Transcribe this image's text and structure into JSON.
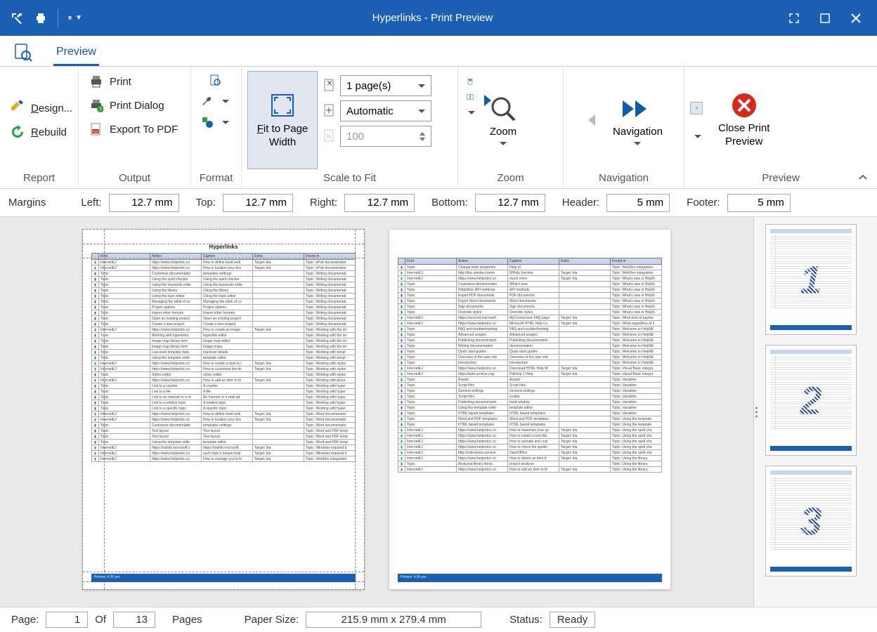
{
  "window": {
    "title": "Hyperlinks - Print Preview"
  },
  "tabs": {
    "preview": "Preview"
  },
  "ribbon": {
    "report": {
      "label": "Report",
      "design": "Design...",
      "rebuild": "Rebuild"
    },
    "output": {
      "label": "Output",
      "print": "Print",
      "print_dialog": "Print Dialog",
      "export_pdf": "Export To PDF"
    },
    "format": {
      "label": "Format"
    },
    "scale": {
      "label": "Scale to Fit",
      "fit_width": "Fit to Page Width",
      "pages_combo": "1 page(s)",
      "auto_combo": "Automatic",
      "zoom_value": "100"
    },
    "zoom": {
      "label": "Zoom",
      "zoom": "Zoom"
    },
    "navigation": {
      "label": "Navigation",
      "navigation": "Navigation"
    },
    "preview": {
      "label": "Preview",
      "close": "Close Print Preview"
    }
  },
  "margins": {
    "label": "Margins",
    "left_l": "Left:",
    "left_v": "12.7 mm",
    "top_l": "Top:",
    "top_v": "12.7 mm",
    "right_l": "Right:",
    "right_v": "12.7 mm",
    "bottom_l": "Bottom:",
    "bottom_v": "12.7 mm",
    "header_l": "Header:",
    "header_v": "5 mm",
    "footer_l": "Footer:",
    "footer_v": "5 mm"
  },
  "document": {
    "title": "Hyperlinks",
    "columns": [
      "Kind",
      "Action",
      "Caption",
      "Extra",
      "Found in"
    ],
    "footer": "Printed: 4:30 pm",
    "page1_rows": [
      [
        "Topic",
        "Change topic properties",
        "Help Id",
        "",
        "Topic: WebDev integration"
      ],
      [
        "InternetEJ",
        "http://doc.windev.com/e",
        "WHelp function",
        "Target: bla",
        "Topic: WebDev integration"
      ],
      [
        "InternetEJ",
        "https://www.helpndoc.co",
        "much more",
        "Target: bla",
        "Topic: What's new in HelpN"
      ],
      [
        "Topic",
        "Customize documentatio",
        "What's new",
        "",
        "Topic: What's new in HelpN"
      ],
      [
        "Topic",
        "HelpNDoc API methods",
        "API methods",
        "",
        "Topic: What's new in HelpN"
      ],
      [
        "Topic",
        "Export PDF documents",
        "PDF documents",
        "",
        "Topic: What's new in HelpN"
      ],
      [
        "Topic",
        "Export Word documents",
        "Word documents",
        "",
        "Topic: What's new in HelpN"
      ],
      [
        "Topic",
        "Sign documents",
        "Sign documents",
        "",
        "Topic: What's new in HelpN"
      ],
      [
        "Topic",
        "Override styles",
        "Override styles",
        "",
        "Topic: What's new in HelpN"
      ],
      [
        "InternetEJ",
        "https://accd.int.microsoft",
        "MyConnernere FAQ page",
        "Target: bla",
        "Topic: What kind of payme"
      ],
      [
        "InternetEJ",
        "https://www.helpndoc.co",
        "Microsoft HTML Help Co",
        "Target: bla",
        "Topic: What regardless of li"
      ],
      [
        "Topic",
        "FAQ and troubleshooting",
        "FAQ and troubleshooting",
        "",
        "Topic: Welcome to HelpNE"
      ],
      [
        "Topic",
        "Advanced usages",
        "Advanced usages",
        "",
        "Topic: Welcome to HelpNE"
      ],
      [
        "Topic",
        "Publishing documentatio",
        "Publishing documentatio",
        "",
        "Topic: Welcome to HelpNE"
      ],
      [
        "Topic",
        "Writing documentation",
        "documentation",
        "",
        "Topic: Welcome to HelpNE"
      ],
      [
        "Topic",
        "Quick start guides",
        "Quick start guides",
        "",
        "Topic: Welcome to HelpNE"
      ],
      [
        "Topic",
        "Overview of the user inte",
        "Overview of the user inte",
        "",
        "Topic: Welcome to HelpNE"
      ],
      [
        "Topic",
        "Introduction",
        "Introduction",
        "",
        "Topic: Welcome to HelpNE"
      ],
      [
        "InternetEJ",
        "https://www.helpndoc.co",
        "Download HTML Help W",
        "Target: bla",
        "Topic: Visual Basic integra"
      ],
      [
        "InternetEJ",
        "https://web.archive.org/",
        "PalHelp 1 Help",
        "Target: bla",
        "Topic: Visual Basic integra"
      ],
      [
        "Topic",
        "Assets",
        "Assets",
        "",
        "Topic: Variables"
      ],
      [
        "Topic",
        "Script files",
        "Script files",
        "",
        "Topic: Variables"
      ],
      [
        "Topic",
        "General settings",
        "General settings",
        "",
        "Topic: Variables"
      ],
      [
        "Topic",
        "Script files",
        "scripts",
        "",
        "Topic: Variables"
      ],
      [
        "Topic",
        "Publishing documentatio",
        "build window",
        "",
        "Topic: Variables"
      ],
      [
        "Topic",
        "Using the template edito",
        "template editor",
        "",
        "Topic: Variables"
      ],
      [
        "Topic",
        "HTML based templates",
        "HTML based templates",
        "",
        "Topic: Variables"
      ],
      [
        "Topic",
        "Word and PDF templates",
        "Word and PDF templates",
        "",
        "Topic: Using the template"
      ],
      [
        "Topic",
        "HTML based templates",
        "HTML based templates",
        "",
        "Topic: Using the template"
      ],
      [
        "InternetEJ",
        "https://www.helpndoc.co",
        "How to maximize your sp",
        "Target: bla",
        "Topic: Using the spell che"
      ],
      [
        "InternetEJ",
        "https://www.helpndoc.co",
        "How to install a new dict",
        "Target: bla",
        "Topic: Using the spell che"
      ],
      [
        "InternetEJ",
        "https://www.helpndoc.co",
        "How to activate and cust",
        "Target: bla",
        "Topic: Using the spell che"
      ],
      [
        "InternetEJ",
        "https://www.helpndoc.co",
        "How to check the spellin",
        "Target: bla",
        "Topic: Using the spell che"
      ],
      [
        "InternetEJ",
        "http://extensions.service",
        "OpenOffice",
        "Target: bla",
        "Topic: Using the spell che"
      ],
      [
        "InternetEJ",
        "https://www.helpndoc.co",
        "How to delete an item fr",
        "Target: bla",
        "Topic: Using the library"
      ],
      [
        "Topic",
        "Analyzed library items",
        "project analyzer",
        "",
        "Topic: Using the library"
      ],
      [
        "InternetEJ",
        "https://www.helpndoc.co",
        "How to add an item to th",
        "Target: bla",
        "Topic: Using the library"
      ]
    ],
    "page0_rows": [
      [
        "InternetEJ",
        "https://www.helpndoc.co",
        "How to define build setti",
        "Target: bla",
        "Topic: ePub documentatio"
      ],
      [
        "InternetEJ",
        "https://www.helpndoc.co",
        "How to localize your doc",
        "Target: bla",
        "Topic: ePub documentatio"
      ],
      [
        "Topic",
        "Customize documentatio",
        "templates settings",
        "",
        "Topic: Writing documentat"
      ],
      [
        "Topic",
        "Using the spell checker",
        "Using the spell checker",
        "",
        "Topic: Writing documentat"
      ],
      [
        "Topic",
        "Using the keywords edito",
        "Using the keywords edito",
        "",
        "Topic: Writing documentat"
      ],
      [
        "Topic",
        "Using the library",
        "Using the library",
        "",
        "Topic: Writing documentat"
      ],
      [
        "Topic",
        "Using the topic editor",
        "Using the topic editor",
        "",
        "Topic: Writing documentat"
      ],
      [
        "Topic",
        "Managing the table of co",
        "Managing the table of co",
        "",
        "Topic: Writing documentat"
      ],
      [
        "Topic",
        "Project options",
        "Project options",
        "",
        "Topic: Writing documentat"
      ],
      [
        "Topic",
        "Import other formats",
        "Import other formats",
        "",
        "Topic: Writing documentat"
      ],
      [
        "Topic",
        "Open an existing project",
        "Open an existing project",
        "",
        "Topic: Writing documentat"
      ],
      [
        "Topic",
        "Create a new project",
        "Create a new project",
        "",
        "Topic: Writing documentat"
      ],
      [
        "InternetEJ",
        "https://www.helpndoc.co",
        "How to create an image",
        "Target: bla",
        "Topic: Working with the im"
      ],
      [
        "Topic",
        "Working with hyperlinks",
        "hyperlink editor",
        "",
        "Topic: Working with the im"
      ],
      [
        "Topic",
        "Image map library item",
        "image map editor",
        "",
        "Topic: Working with the im"
      ],
      [
        "Topic",
        "Image map library item",
        "Image maps",
        "",
        "Topic: Working with the im"
      ],
      [
        "Topic",
        "Low-level template deta",
        "low-level details",
        "",
        "Topic: Working with templ"
      ],
      [
        "Topic",
        "Using the template edito",
        "template editor",
        "",
        "Topic: Working with templ"
      ],
      [
        "InternetEJ",
        "https://www.helpndoc.co",
        "How to create a style in t",
        "Target: bla",
        "Topic: Working with styles"
      ],
      [
        "InternetEJ",
        "https://www.helpndoc.co",
        "How to customize the de",
        "Target: bla",
        "Topic: Working with styles"
      ],
      [
        "Topic",
        "Styles editor",
        "styles editor",
        "",
        "Topic: Working with styles"
      ],
      [
        "InternetEJ",
        "https://www.helpndoc.co",
        "How to add an item to th",
        "Target: bla",
        "Topic: Working with pictur"
      ],
      [
        "Topic",
        "Link to a counter",
        "A counter",
        "",
        "Topic: Working with hyper"
      ],
      [
        "Topic",
        "Link to a file",
        "A file",
        "",
        "Topic: Working with hyper"
      ],
      [
        "Topic",
        "Link to an Internet or e-m",
        "An Internet or e-mail ad",
        "",
        "Topic: Working with hyper"
      ],
      [
        "Topic",
        "Link to a relative topic",
        "A relative topic",
        "",
        "Topic: Working with hyper"
      ],
      [
        "Topic",
        "Link to a specific topic",
        "A specific topic",
        "",
        "Topic: Working with hyper"
      ],
      [
        "InternetEJ",
        "https://www.helpndoc.co",
        "How to define build setti",
        "Target: bla",
        "Topic: Word documentatio"
      ],
      [
        "InternetEJ",
        "https://www.helpndoc.co",
        "How to localize your doc",
        "Target: bla",
        "Topic: Word documentatio"
      ],
      [
        "Topic",
        "Customize documentatio",
        "templates settings",
        "",
        "Topic: Word documentatio"
      ],
      [
        "Topic",
        "Text layout",
        "Text layout",
        "",
        "Topic: Word and PDF temp"
      ],
      [
        "Topic",
        "Text layout",
        "Text layout",
        "",
        "Topic: Word and PDF temp"
      ],
      [
        "Topic",
        "Using the template edito",
        "template editor",
        "",
        "Topic: Word and PDF temp"
      ],
      [
        "InternetEJ",
        "https://visible.microsoft.c",
        "https://visible.microsoft",
        "Target: bla",
        "Topic: Windows required li"
      ],
      [
        "InternetEJ",
        "https://www.helpndoc.co",
        "each topic's unique help",
        "Target: bla",
        "Topic: Windows required li"
      ],
      [
        "InternetEJ",
        "https://www.helpndoc.co",
        "How to manage you're hi",
        "Target: bla",
        "Topic: WebDev integration"
      ]
    ]
  },
  "status": {
    "page_l": "Page:",
    "page_v": "1",
    "of_l": "Of",
    "of_v": "13",
    "pages_l": "Pages",
    "paper_l": "Paper Size:",
    "paper_v": "215.9 mm x 279.4 mm",
    "status_l": "Status:",
    "status_v": "Ready"
  },
  "chart_data": null
}
